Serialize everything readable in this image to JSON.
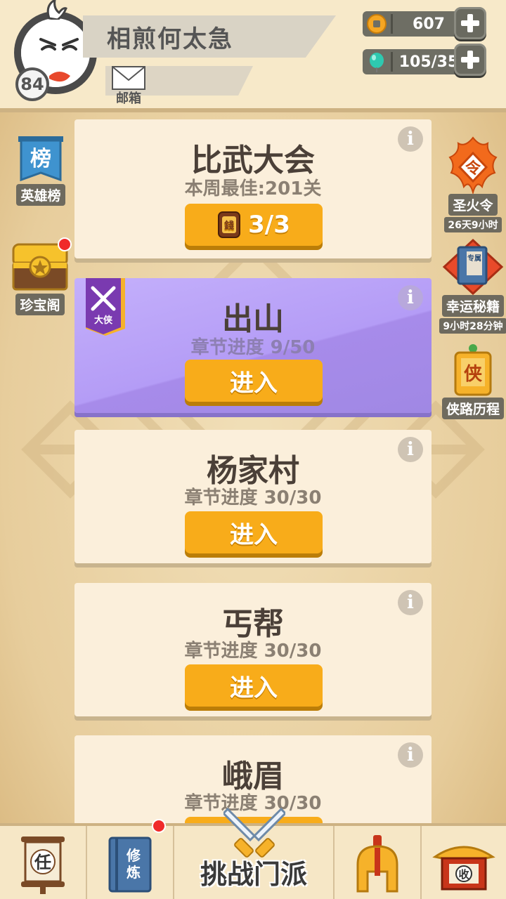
{
  "player": {
    "name": "相煎何太急",
    "level": "84",
    "mail_label": "邮箱"
  },
  "resources": {
    "coins": "607",
    "gems": "105/35"
  },
  "left_side": {
    "ranking_label": "英雄榜",
    "ranking_glyph": "榜",
    "treasure_label": "珍宝阁"
  },
  "right_side": {
    "fire_label": "圣火令",
    "fire_glyph": "令",
    "fire_timer": "26天9小时",
    "book_label": "幸运秘籍",
    "book_glyph": "专属",
    "book_timer": "9小时28分钟",
    "journey_label": "侠路历程",
    "journey_glyph": "侠"
  },
  "cards": [
    {
      "title": "比武大会",
      "subtitle": "本周最佳:201关",
      "button": "3/3",
      "ticket_glyph": "錢"
    },
    {
      "title": "出山",
      "subtitle": "章节进度 9/50",
      "button": "进入",
      "badge": "大侠"
    },
    {
      "title": "杨家村",
      "subtitle": "章节进度 30/30",
      "button": "进入"
    },
    {
      "title": "丐帮",
      "subtitle": "章节进度 30/30",
      "button": "进入"
    },
    {
      "title": "峨眉",
      "subtitle": "章节进度 30/30"
    }
  ],
  "info_glyph": "i",
  "bottom_nav": {
    "task_glyph": "任",
    "train_glyph1": "修",
    "train_glyph2": "炼",
    "center_label": "挑战门派",
    "collect_glyph": "收"
  },
  "colors": {
    "accent_orange": "#f8ac1a",
    "purple_card": "#b49cf6",
    "badge_red": "#f02a2a"
  }
}
